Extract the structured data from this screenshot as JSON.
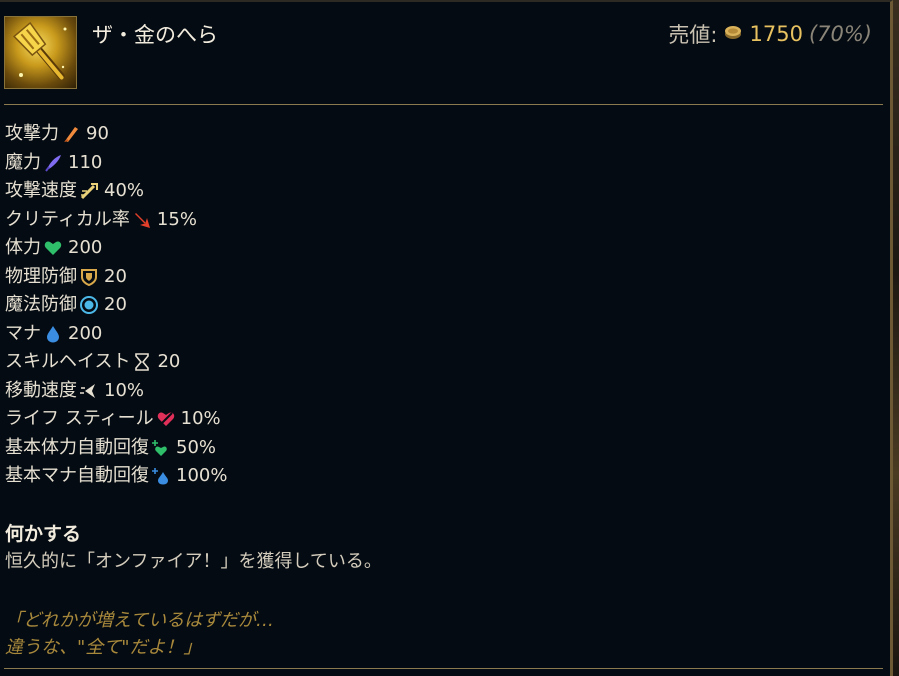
{
  "item": {
    "name": "ザ・金のへら",
    "icon": "golden-spatula-icon",
    "sell_label": "売値:",
    "sell_value": "1750",
    "sell_percent": "(70%)"
  },
  "stats": [
    {
      "label": "攻撃力",
      "icon": "attack-damage-icon",
      "value": "90",
      "color": "#f08a3c"
    },
    {
      "label": "魔力",
      "icon": "ability-power-icon",
      "value": "110",
      "color": "#7f6cf0"
    },
    {
      "label": "攻撃速度",
      "icon": "attack-speed-icon",
      "value": "40%",
      "color": "#e9d27a"
    },
    {
      "label": "クリティカル率",
      "icon": "crit-chance-icon",
      "value": "15%",
      "color": "#e2402a"
    },
    {
      "label": "体力",
      "icon": "health-icon",
      "value": "200",
      "color": "#2fbf6a"
    },
    {
      "label": "物理防御",
      "icon": "armor-icon",
      "value": "20",
      "color": "#d9a84a"
    },
    {
      "label": "魔法防御",
      "icon": "magic-resist-icon",
      "value": "20",
      "color": "#4cb8e8"
    },
    {
      "label": "マナ",
      "icon": "mana-icon",
      "value": "200",
      "color": "#3a8de0"
    },
    {
      "label": "スキルヘイスト",
      "icon": "ability-haste-icon",
      "value": "20",
      "color": "#e6e0d2"
    },
    {
      "label": "移動速度",
      "icon": "move-speed-icon",
      "value": "10%",
      "color": "#e6e0d2"
    },
    {
      "label": "ライフ スティール",
      "icon": "life-steal-icon",
      "value": "10%",
      "color": "#e0305a"
    },
    {
      "label": "基本体力自動回復",
      "icon": "health-regen-icon",
      "value": "50%",
      "color": "#2fbf6a"
    },
    {
      "label": "基本マナ自動回復",
      "icon": "mana-regen-icon",
      "value": "100%",
      "color": "#3a8de0"
    }
  ],
  "passive": {
    "title": "何かする",
    "description": "恒久的に「オンファイア！」を獲得している。"
  },
  "flavor": {
    "line1": "「どれかが増えているはずだが…",
    "line2": "違うな、\"全て\"だよ！」"
  }
}
